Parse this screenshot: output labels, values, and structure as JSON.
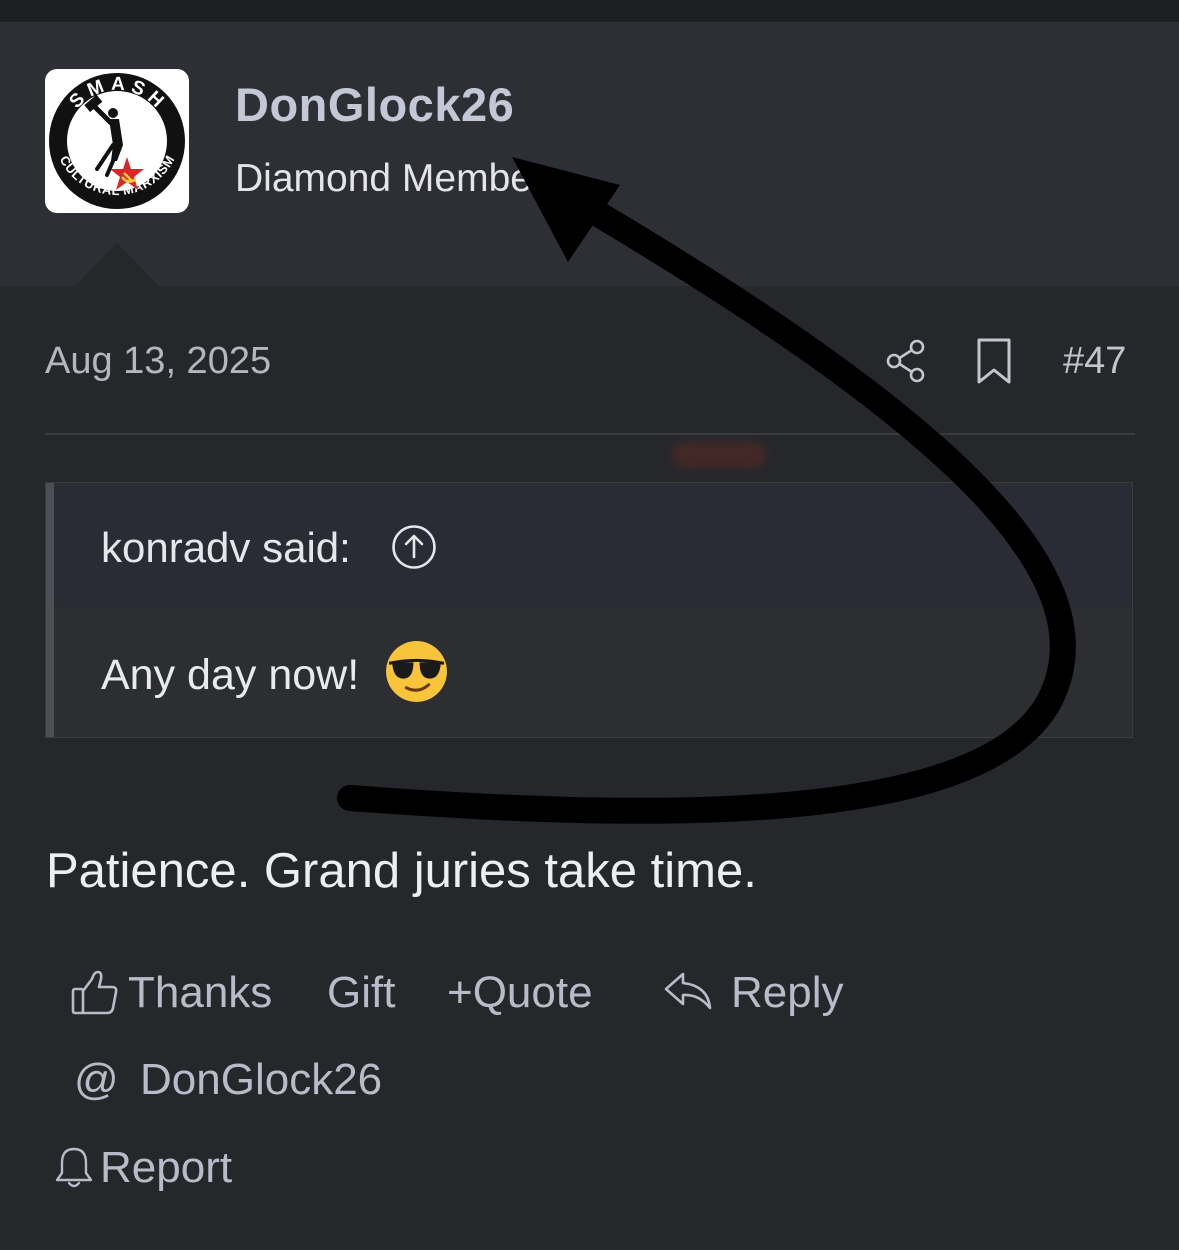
{
  "user": {
    "name": "DonGlock26",
    "title": "Diamond Member",
    "avatar_lines": [
      "SMASH",
      "CULTURAL MARXISM"
    ]
  },
  "post": {
    "date": "Aug 13, 2025",
    "number": "#47",
    "body": "Patience. Grand juries take time."
  },
  "quote": {
    "author": "konradv said:",
    "text": "Any day now!",
    "emoji": "smiling-face-with-sunglasses"
  },
  "actions": {
    "thanks": "Thanks",
    "gift": "Gift",
    "quote_plus": "+",
    "quote": "Quote",
    "reply": "Reply",
    "mention_symbol": "@",
    "mention": "DonGlock26",
    "report": "Report"
  },
  "icons": {
    "share": "share-icon",
    "bookmark": "bookmark-icon",
    "jump": "arrow-up-circle-icon",
    "thanks": "thumbs-up-icon",
    "reply": "reply-arrow-icon",
    "report": "bell-icon"
  },
  "colors": {
    "page_bg": "#26272b",
    "header_bg": "#2e2f34",
    "username": "#c3c7d6",
    "action_text": "#b8bcc8",
    "quote_head_bg": "#2a2b35",
    "flag_red": "#d8282a",
    "emoji_yellow": "#f7c43a"
  }
}
